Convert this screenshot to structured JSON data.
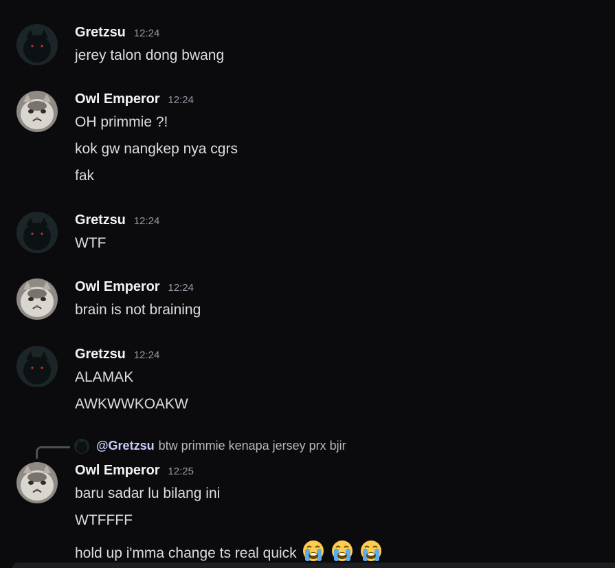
{
  "messages": [
    {
      "author": "Gretzsu",
      "time": "12:24",
      "avatar": "black-cat-avatar",
      "lines": [
        "jerey talon dong bwang"
      ]
    },
    {
      "author": "Owl Emperor",
      "time": "12:24",
      "avatar": "crying-cat-avatar",
      "lines": [
        "OH primmie ?!",
        "kok gw nangkep nya cgrs",
        "fak"
      ]
    },
    {
      "author": "Gretzsu",
      "time": "12:24",
      "avatar": "black-cat-avatar",
      "lines": [
        "WTF"
      ]
    },
    {
      "author": "Owl Emperor",
      "time": "12:24",
      "avatar": "crying-cat-avatar",
      "lines": [
        "brain is not braining"
      ]
    },
    {
      "author": "Gretzsu",
      "time": "12:24",
      "avatar": "black-cat-avatar",
      "lines": [
        "ALAMAK",
        "AWKWWKOAKW"
      ]
    },
    {
      "author": "Owl Emperor",
      "time": "12:25",
      "avatar": "crying-cat-avatar",
      "reply": {
        "mention": "@Gretzsu",
        "text": "btw primmie kenapa jersey prx bjir"
      },
      "lines": [
        "baru sadar lu bilang ini",
        "WTFFFF",
        "hold up i'mma change ts real quick"
      ],
      "emojis": [
        "loudly-crying-face-emoji",
        "loudly-crying-face-emoji",
        "loudly-crying-face-emoji"
      ]
    }
  ],
  "colors": {
    "background": "#0b0b0e",
    "author": "#f2f3f5",
    "timestamp": "#949ba4",
    "text": "#dbdee1",
    "mention": "#c9cdfb"
  }
}
